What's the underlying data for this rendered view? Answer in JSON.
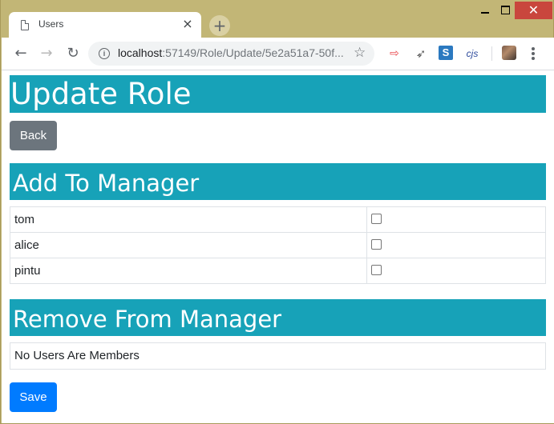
{
  "browser": {
    "tab_title": "Users",
    "tab_close": "×",
    "new_tab": "+",
    "url_host": "localhost",
    "url_rest": ":57149/Role/Update/5e2a51a7-50f...",
    "window_close": "✕",
    "extensions": [
      {
        "name": "arrow-extension-icon",
        "glyph": "⇨"
      },
      {
        "name": "rocket-extension-icon",
        "glyph": "🚀"
      },
      {
        "name": "s-extension-icon",
        "glyph": "S"
      },
      {
        "name": "cjs-extension-icon",
        "glyph": "cjs"
      }
    ]
  },
  "page": {
    "title": "Update Role",
    "back_label": "Back",
    "add_heading": "Add To Manager",
    "remove_heading": "Remove From Manager",
    "users": [
      {
        "name": "tom",
        "checked": false
      },
      {
        "name": "alice",
        "checked": false
      },
      {
        "name": "pintu",
        "checked": false
      }
    ],
    "no_members_text": "No Users Are Members",
    "save_label": "Save"
  },
  "colors": {
    "banner": "#17a2b8",
    "back_button": "#6c757d",
    "save_button": "#007bff",
    "window_frame": "#c2b676",
    "close_button": "#c9463d"
  }
}
